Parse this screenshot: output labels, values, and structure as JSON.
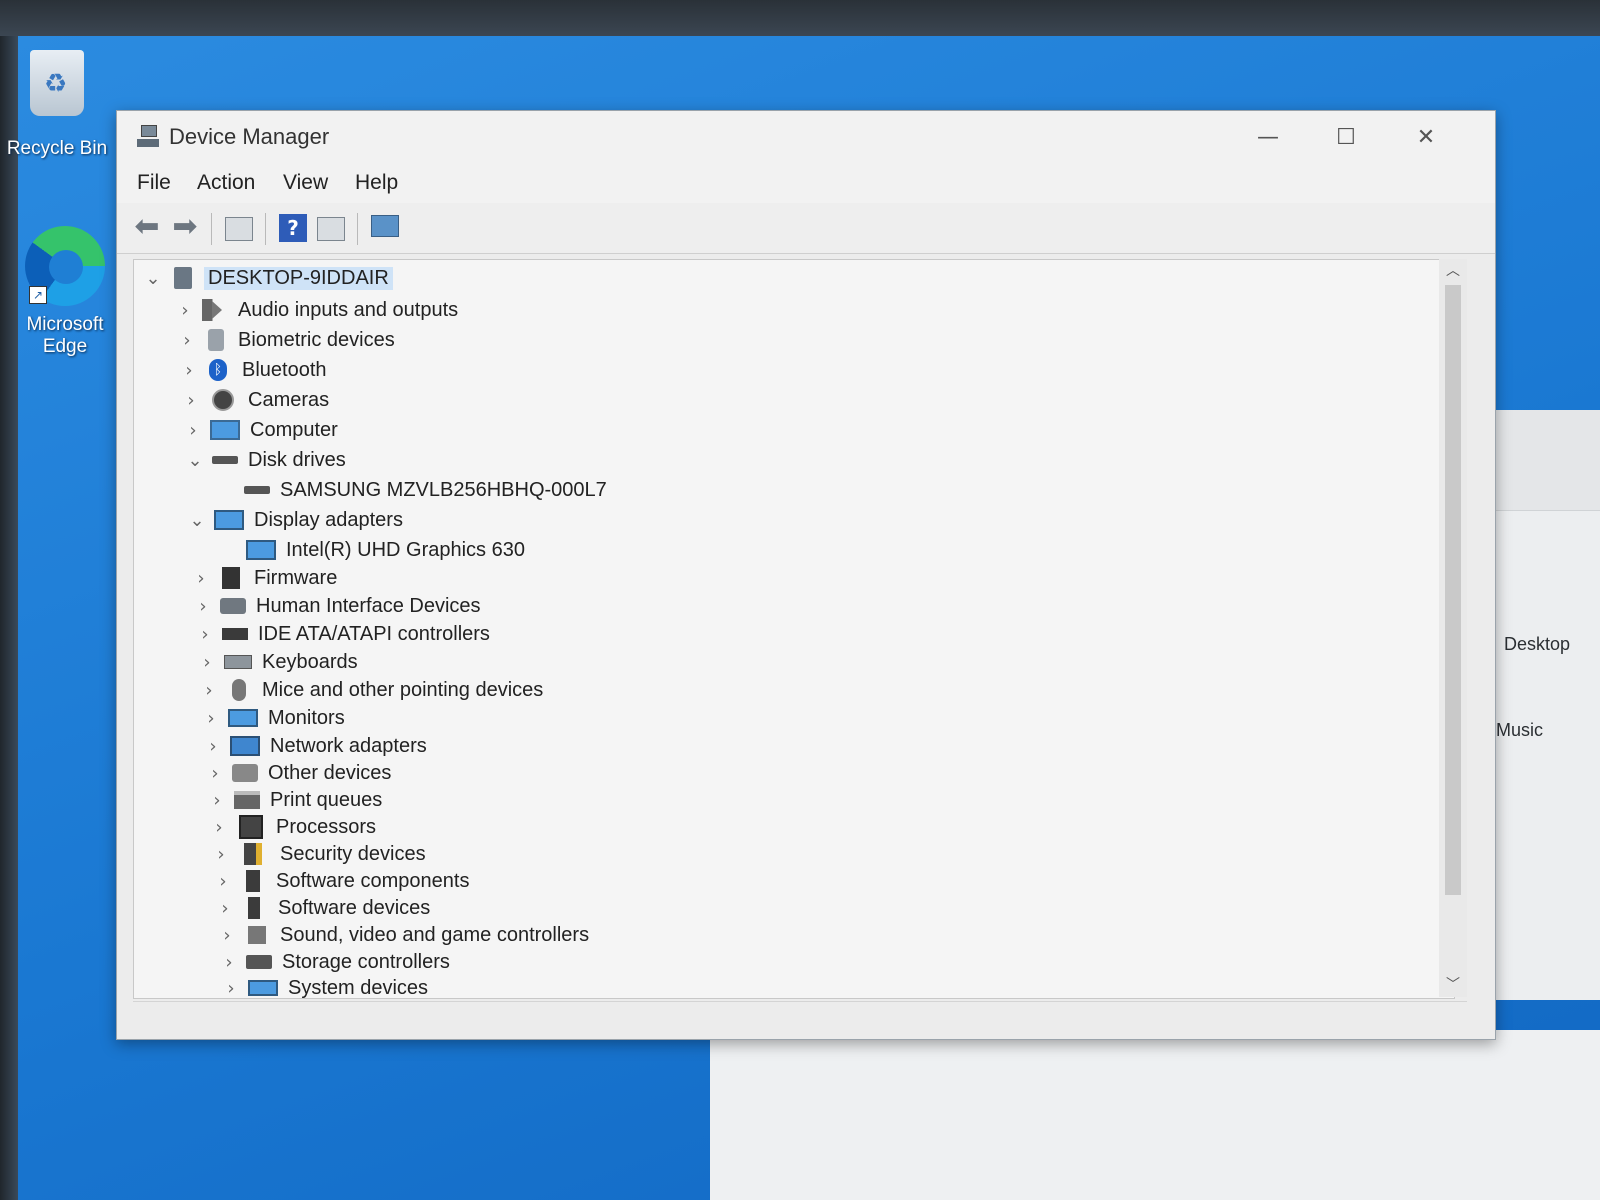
{
  "desktop": {
    "icons": [
      {
        "label": "Recycle Bin"
      },
      {
        "label": "Microsoft Edge"
      }
    ],
    "explorer_items": [
      {
        "label": "Desktop"
      },
      {
        "label": "Music"
      }
    ]
  },
  "window": {
    "title": "Device Manager",
    "controls": {
      "minimize": "—",
      "maximize": "☐",
      "close": "✕"
    },
    "menu": [
      "File",
      "Action",
      "View",
      "Help"
    ],
    "toolbar_icons": [
      "back-arrow-icon",
      "forward-arrow-icon",
      "properties-icon",
      "help-icon",
      "view-icon",
      "monitor-icon"
    ]
  },
  "tree": {
    "root": "DESKTOP-9IDDAIR",
    "items": [
      {
        "label": "Audio inputs and outputs",
        "expanded": false,
        "icon": "speaker-icon"
      },
      {
        "label": "Biometric devices",
        "expanded": false,
        "icon": "biometric-icon"
      },
      {
        "label": "Bluetooth",
        "expanded": false,
        "icon": "bluetooth-icon"
      },
      {
        "label": "Cameras",
        "expanded": false,
        "icon": "camera-icon"
      },
      {
        "label": "Computer",
        "expanded": false,
        "icon": "computer-icon"
      },
      {
        "label": "Disk drives",
        "expanded": true,
        "icon": "disk-icon",
        "children": [
          "SAMSUNG MZVLB256HBHQ-000L7"
        ]
      },
      {
        "label": "Display adapters",
        "expanded": true,
        "icon": "display-adapter-icon",
        "children": [
          "Intel(R) UHD Graphics 630"
        ]
      },
      {
        "label": "Firmware",
        "expanded": false,
        "icon": "firmware-icon"
      },
      {
        "label": "Human Interface Devices",
        "expanded": false,
        "icon": "hid-icon"
      },
      {
        "label": "IDE ATA/ATAPI controllers",
        "expanded": false,
        "icon": "ide-icon"
      },
      {
        "label": "Keyboards",
        "expanded": false,
        "icon": "keyboard-icon"
      },
      {
        "label": "Mice and other pointing devices",
        "expanded": false,
        "icon": "mouse-icon"
      },
      {
        "label": "Monitors",
        "expanded": false,
        "icon": "monitor-icon"
      },
      {
        "label": "Network adapters",
        "expanded": false,
        "icon": "network-icon"
      },
      {
        "label": "Other devices",
        "expanded": false,
        "icon": "other-devices-icon"
      },
      {
        "label": "Print queues",
        "expanded": false,
        "icon": "printer-icon"
      },
      {
        "label": "Processors",
        "expanded": false,
        "icon": "processor-icon"
      },
      {
        "label": "Security devices",
        "expanded": false,
        "icon": "security-icon"
      },
      {
        "label": "Software components",
        "expanded": false,
        "icon": "software-component-icon"
      },
      {
        "label": "Software devices",
        "expanded": false,
        "icon": "software-device-icon"
      },
      {
        "label": "Sound, video and game controllers",
        "expanded": false,
        "icon": "sound-icon"
      },
      {
        "label": "Storage controllers",
        "expanded": false,
        "icon": "storage-icon"
      },
      {
        "label": "System devices",
        "expanded": false,
        "icon": "system-icon"
      }
    ],
    "expanded_caret": "⌄",
    "collapsed_caret": "›"
  }
}
